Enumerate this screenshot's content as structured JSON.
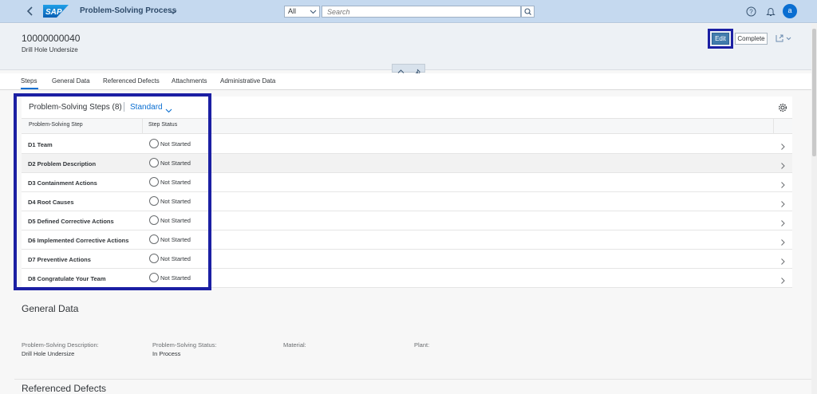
{
  "shell": {
    "app_title": "Problem-Solving Process",
    "search_scope": "All",
    "search_placeholder": "Search",
    "avatar_initial": "a",
    "logo_text": "SAP"
  },
  "header": {
    "object_id": "10000000040",
    "object_subtitle": "Drill Hole Undersize",
    "edit_label": "Edit",
    "complete_label": "Complete"
  },
  "tabs": [
    {
      "label": "Steps",
      "active": true
    },
    {
      "label": "General Data"
    },
    {
      "label": "Referenced Defects"
    },
    {
      "label": "Attachments"
    },
    {
      "label": "Administrative Data"
    }
  ],
  "steps_table": {
    "title": "Problem-Solving Steps (8)",
    "variant": "Standard",
    "columns": [
      "Problem-Solving Step",
      "Step Status"
    ],
    "rows": [
      {
        "step": "D1 Team",
        "status": "Not Started"
      },
      {
        "step": "D2 Problem Description",
        "status": "Not Started"
      },
      {
        "step": "D3 Containment Actions",
        "status": "Not Started"
      },
      {
        "step": "D4 Root Causes",
        "status": "Not Started"
      },
      {
        "step": "D5 Defined Corrective Actions",
        "status": "Not Started"
      },
      {
        "step": "D6 Implemented Corrective Actions",
        "status": "Not Started"
      },
      {
        "step": "D7 Preventive Actions",
        "status": "Not Started"
      },
      {
        "step": "D8 Congratulate Your Team",
        "status": "Not Started"
      }
    ]
  },
  "general_data": {
    "title": "General Data",
    "fields": [
      {
        "label": "Problem-Solving Description:",
        "value": "Drill Hole Undersize"
      },
      {
        "label": "Problem-Solving Status:",
        "value": "In Process"
      },
      {
        "label": "Material:",
        "value": ""
      },
      {
        "label": "Plant:",
        "value": ""
      }
    ]
  },
  "referenced_defects": {
    "title": "Referenced Defects"
  },
  "colors": {
    "shell_bg": "#c5d9ef",
    "accent": "#0a6ed1",
    "highlight_border": "#1b1fa3",
    "edit_button": "#427cac"
  }
}
